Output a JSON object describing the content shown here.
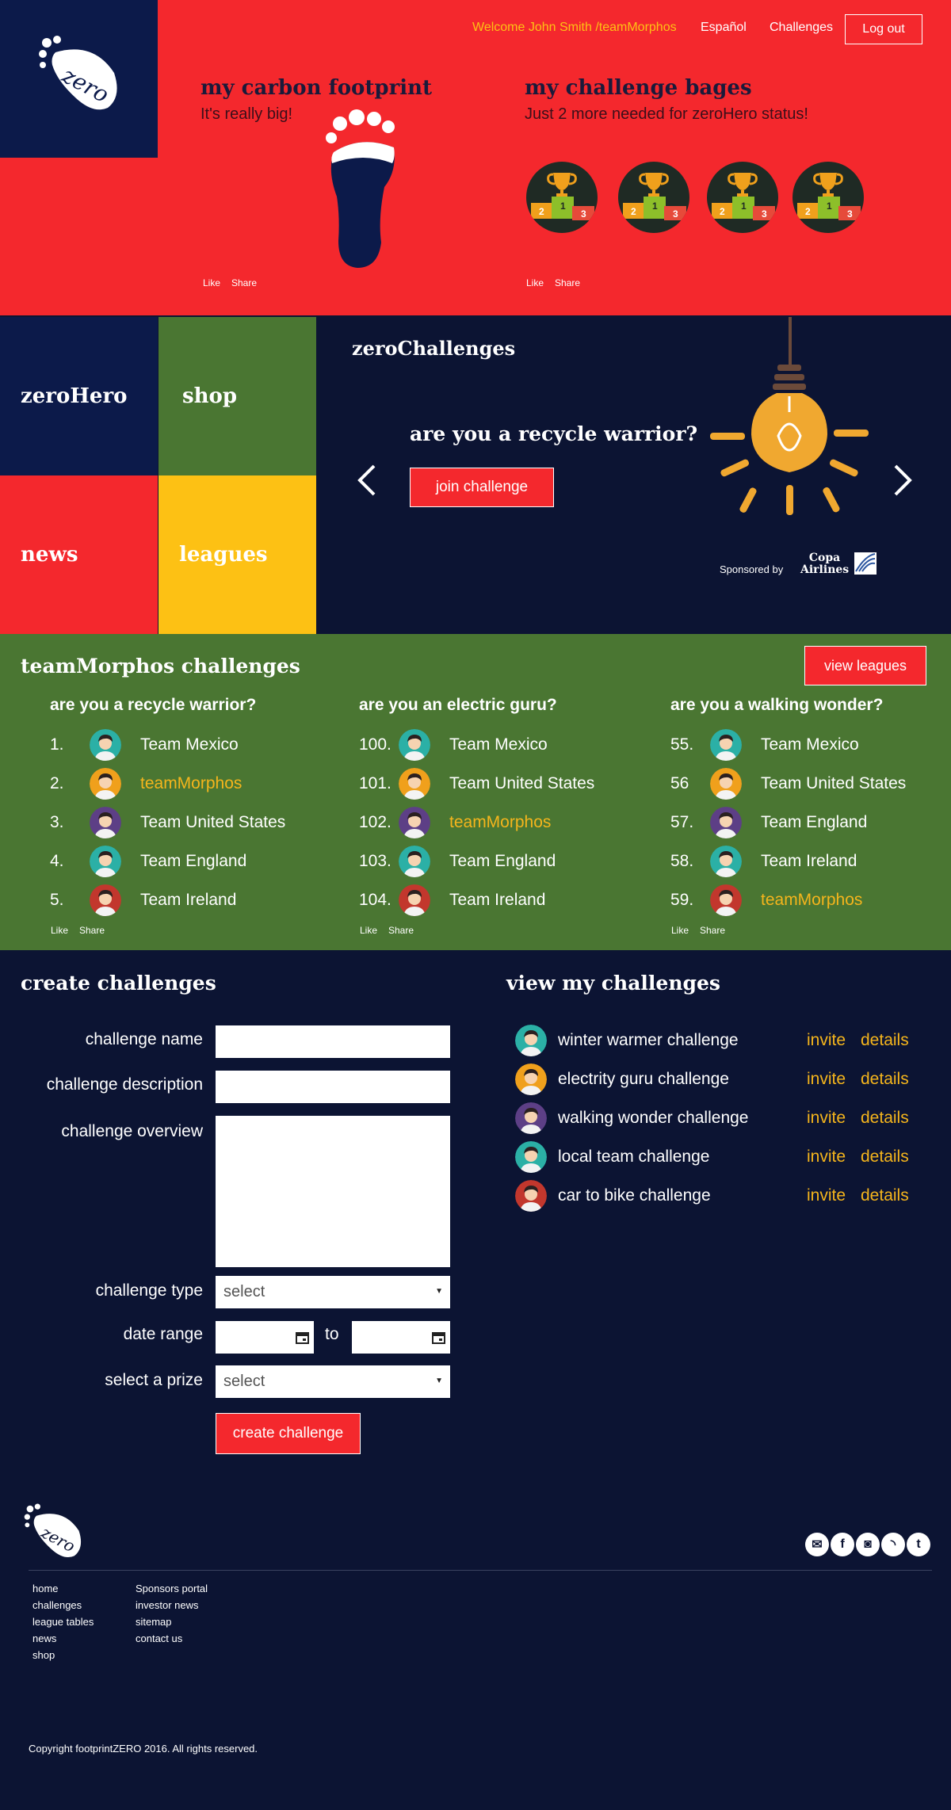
{
  "header": {
    "welcome": "Welcome John Smith /teamMorphos",
    "language": "Español",
    "challenges_link": "Challenges",
    "logout": "Log out",
    "logo_text": "zero",
    "carbon": {
      "title": "my carbon footprint",
      "subtitle": "It's really big!",
      "like": "Like",
      "share": "Share"
    },
    "badges": {
      "title": "my challenge bages",
      "subtitle": "Just 2 more needed for zeroHero status!",
      "like": "Like",
      "share": "Share",
      "podium": [
        "2",
        "1",
        "3"
      ]
    }
  },
  "tiles": [
    {
      "label": "zeroHero",
      "color": "#0c1a4a"
    },
    {
      "label": "shop",
      "color": "#4a7632"
    },
    {
      "label": "news",
      "color": "#f4282d"
    },
    {
      "label": "leagues",
      "color": "#fdc114"
    }
  ],
  "hero": {
    "title": "zeroChallenges",
    "question": "are you a recycle warrior?",
    "join_button": "join challenge",
    "sponsored_by": "Sponsored by",
    "sponsor_line1": "Copa",
    "sponsor_line2": "Airlines"
  },
  "team": {
    "title": "teamMorphos challenges",
    "view_leagues": "view leagues",
    "columns": [
      {
        "title": "are you a recycle warrior?",
        "rows": [
          {
            "rank": "1.",
            "name": "Team Mexico"
          },
          {
            "rank": "2.",
            "name": "teamMorphos"
          },
          {
            "rank": "3.",
            "name": "Team United States"
          },
          {
            "rank": "4.",
            "name": "Team England"
          },
          {
            "rank": "5.",
            "name": "Team Ireland"
          }
        ]
      },
      {
        "title": "are you an electric guru?",
        "rows": [
          {
            "rank": "100.",
            "name": "Team Mexico"
          },
          {
            "rank": "101.",
            "name": "Team United States"
          },
          {
            "rank": "102.",
            "name": "teamMorphos"
          },
          {
            "rank": "103.",
            "name": "Team England"
          },
          {
            "rank": "104.",
            "name": "Team Ireland"
          }
        ]
      },
      {
        "title": "are you a walking wonder?",
        "rows": [
          {
            "rank": "55.",
            "name": "Team Mexico"
          },
          {
            "rank": "56",
            "name": "Team United States"
          },
          {
            "rank": "57.",
            "name": "Team England"
          },
          {
            "rank": "58.",
            "name": "Team Ireland"
          },
          {
            "rank": "59.",
            "name": "teamMorphos"
          }
        ]
      }
    ],
    "like": "Like",
    "share": "Share",
    "avatar_colors": [
      "#2bb0a6",
      "#f0a01c",
      "#5d3f86",
      "#2bb0a6",
      "#c2372d"
    ]
  },
  "create": {
    "title": "create challenges",
    "name_label": "challenge name",
    "description_label": "challenge description",
    "overview_label": "challenge overview",
    "type_label": "challenge type",
    "type_value": "select",
    "date_label": "date range",
    "to": "to",
    "prize_label": "select a prize",
    "prize_value": "select",
    "button": "create challenge"
  },
  "mine": {
    "title": "view my challenges",
    "items": [
      {
        "name": "winter warmer challenge",
        "invite": "invite",
        "details": "details"
      },
      {
        "name": "electrity guru challenge",
        "invite": "invite",
        "details": "details"
      },
      {
        "name": "walking wonder challenge",
        "invite": "invite",
        "details": "details"
      },
      {
        "name": "local team challenge",
        "invite": "invite",
        "details": "details"
      },
      {
        "name": "car to bike challenge",
        "invite": "invite",
        "details": "details"
      }
    ]
  },
  "footer": {
    "logo_text": "zero",
    "col1": [
      "home",
      "challenges",
      "league tables",
      "news",
      "shop"
    ],
    "col2": [
      "Sponsors portal",
      "investor news",
      "sitemap",
      "contact us"
    ],
    "copyright": "Copyright footprintZERO 2016. All rights reserved.",
    "social": [
      "email-icon",
      "facebook-icon",
      "instagram-icon",
      "rss-icon",
      "twitter-icon"
    ]
  }
}
